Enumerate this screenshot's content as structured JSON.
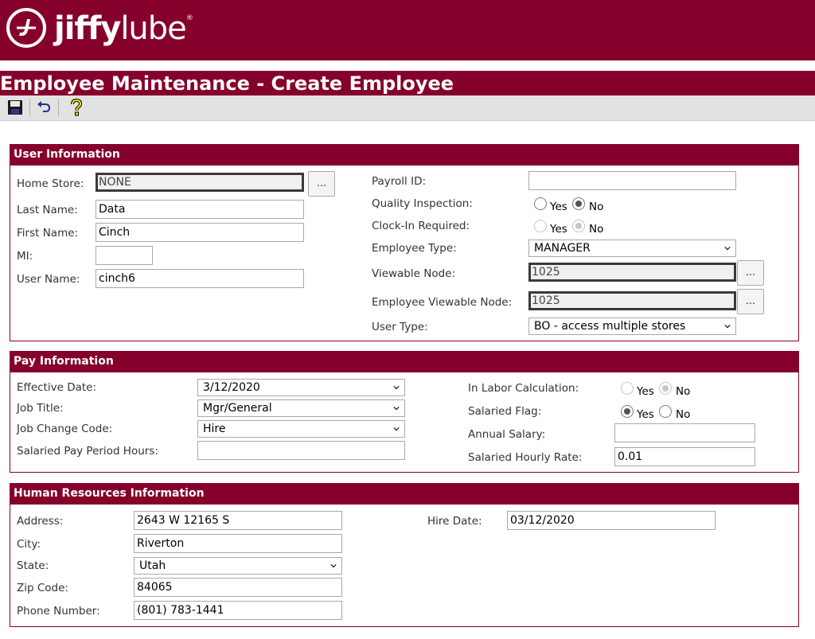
{
  "header": {
    "logo_bold": "jiffy",
    "logo_light": "lube",
    "logo_mark": "®"
  },
  "page": {
    "title": "Employee Maintenance - Create Employee"
  },
  "toolbar": {
    "icons": [
      "save-icon",
      "undo-icon",
      "help-icon"
    ]
  },
  "user_info": {
    "heading": "User Information",
    "home_store_label": "Home Store:",
    "home_store_value": "NONE",
    "browse_label": "...",
    "last_name_label": "Last Name:",
    "last_name_value": "Data",
    "first_name_label": "First Name:",
    "first_name_value": "Cinch",
    "mi_label": "MI:",
    "mi_value": "",
    "user_name_label": "User Name:",
    "user_name_value": "cinch6",
    "payroll_id_label": "Payroll ID:",
    "payroll_id_value": "",
    "quality_label": "Quality Inspection:",
    "clockin_label": "Clock-In Required:",
    "yes_label": "Yes",
    "no_label": "No",
    "employee_type_label": "Employee Type:",
    "employee_type_value": "MANAGER",
    "viewable_node_label": "Viewable Node:",
    "viewable_node_value": "1025",
    "emp_viewable_node_label": "Employee Viewable Node:",
    "emp_viewable_node_value": "1025",
    "user_type_label": "User Type:",
    "user_type_value": "BO - access multiple stores"
  },
  "pay_info": {
    "heading": "Pay Information",
    "effective_date_label": "Effective Date:",
    "effective_date_value": "3/12/2020",
    "job_title_label": "Job Title:",
    "job_title_value": "Mgr/General",
    "job_change_label": "Job Change Code:",
    "job_change_value": "Hire",
    "salaried_hours_label": "Salaried Pay Period Hours:",
    "salaried_hours_value": "",
    "labor_calc_label": "In Labor Calculation:",
    "salaried_flag_label": "Salaried Flag:",
    "annual_salary_label": "Annual Salary:",
    "annual_salary_value": "",
    "hourly_rate_label": "Salaried Hourly Rate:",
    "hourly_rate_value": "0.01",
    "yes_label": "Yes",
    "no_label": "No"
  },
  "hr_info": {
    "heading": "Human Resources Information",
    "address_label": "Address:",
    "address_value": "2643 W 12165 S",
    "city_label": "City:",
    "city_value": "Riverton",
    "state_label": "State:",
    "state_value": "Utah",
    "zip_label": "Zip Code:",
    "zip_value": "84065",
    "phone_label": "Phone Number:",
    "phone_value": "(801) 783-1441",
    "hire_date_label": "Hire Date:",
    "hire_date_value": "03/12/2020"
  },
  "colors": {
    "brand": "#85002b",
    "toolbar": "#e2e2e2"
  }
}
